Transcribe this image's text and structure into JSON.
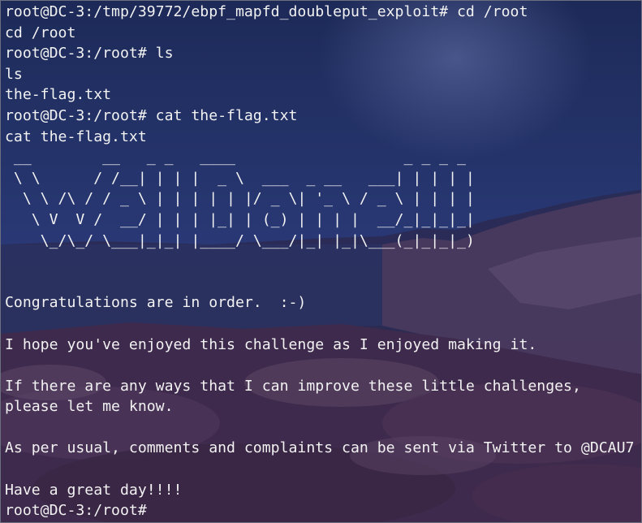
{
  "terminal": {
    "lines": [
      "root@DC-3:/tmp/39772/ebpf_mapfd_doubleput_exploit# cd /root",
      "cd /root",
      "root@DC-3:/root# ls",
      "ls",
      "the-flag.txt",
      "root@DC-3:/root# cat the-flag.txt",
      "cat the-flag.txt",
      " __        __   _ _   ____                   _ _ _ _",
      " \\ \\      / /__| | | |  _ \\  ___  _ __   ___| | | | |",
      "  \\ \\ /\\ / / _ \\ | | | | | |/ _ \\| '_ \\ / _ \\ | | | |",
      "   \\ V  V /  __/ | | | |_| | (_) | | | |  __/_|_|_|_|",
      "    \\_/\\_/ \\___|_|_| |____/ \\___/|_| |_|\\___(_|_|_|_)",
      "",
      "",
      "Congratulations are in order.  :-)",
      "",
      "I hope you've enjoyed this challenge as I enjoyed making it.",
      "",
      "If there are any ways that I can improve these little challenges,",
      "please let me know.",
      "",
      "As per usual, comments and complaints can be sent via Twitter to @DCAU7",
      "",
      "Have a great day!!!!",
      "root@DC-3:/root# "
    ]
  },
  "colors": {
    "text": "#f2f2f2",
    "sky_top": "#1d2a58",
    "sky_mid": "#2a3976",
    "shore": "#3d2846"
  }
}
